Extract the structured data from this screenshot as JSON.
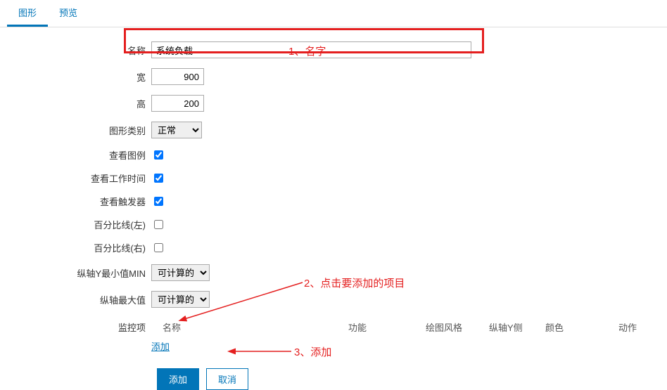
{
  "tabs": {
    "graph": "图形",
    "preview": "预览"
  },
  "form": {
    "name_label": "名称",
    "name_value": "系统负载",
    "width_label": "宽",
    "width_value": "900",
    "height_label": "高",
    "height_value": "200",
    "graph_type_label": "图形类别",
    "graph_type_value": "正常",
    "legend_label": "查看图例",
    "worktime_label": "查看工作时间",
    "triggers_label": "查看触发器",
    "pct_left_label": "百分比线(左)",
    "pct_right_label": "百分比线(右)",
    "ymin_label": "纵轴Y最小值MIN",
    "ymin_value": "可计算的",
    "ymax_label": "纵轴最大值",
    "ymax_value": "可计算的",
    "items_label": "监控项"
  },
  "table": {
    "col_name": "名称",
    "col_func": "功能",
    "col_style": "绘图风格",
    "col_yside": "纵轴Y侧",
    "col_color": "颜色",
    "col_action": "动作",
    "add_link": "添加"
  },
  "actions": {
    "add": "添加",
    "cancel": "取消"
  },
  "annotations": {
    "a1": "1、名字",
    "a2": "2、点击要添加的项目",
    "a3": "3、添加"
  }
}
